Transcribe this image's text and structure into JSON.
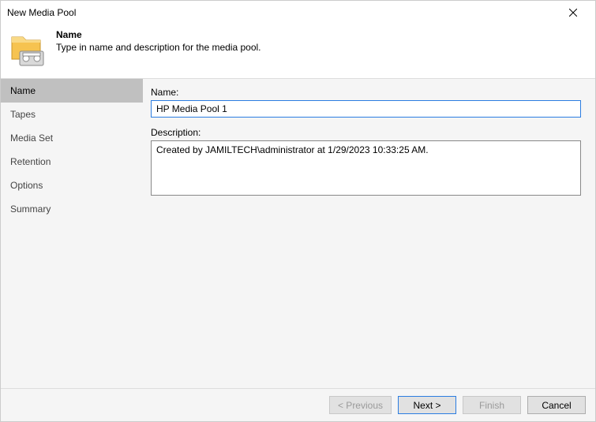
{
  "window": {
    "title": "New Media Pool"
  },
  "header": {
    "title": "Name",
    "subtitle": "Type in name and description for the media pool."
  },
  "sidebar": {
    "items": [
      {
        "label": "Name",
        "active": true
      },
      {
        "label": "Tapes",
        "active": false
      },
      {
        "label": "Media Set",
        "active": false
      },
      {
        "label": "Retention",
        "active": false
      },
      {
        "label": "Options",
        "active": false
      },
      {
        "label": "Summary",
        "active": false
      }
    ]
  },
  "form": {
    "name_label": "Name:",
    "name_value": "HP Media Pool 1",
    "description_label": "Description:",
    "description_value": "Created by JAMILTECH\\administrator at 1/29/2023 10:33:25 AM."
  },
  "footer": {
    "previous": "< Previous",
    "next": "Next >",
    "finish": "Finish",
    "cancel": "Cancel"
  }
}
